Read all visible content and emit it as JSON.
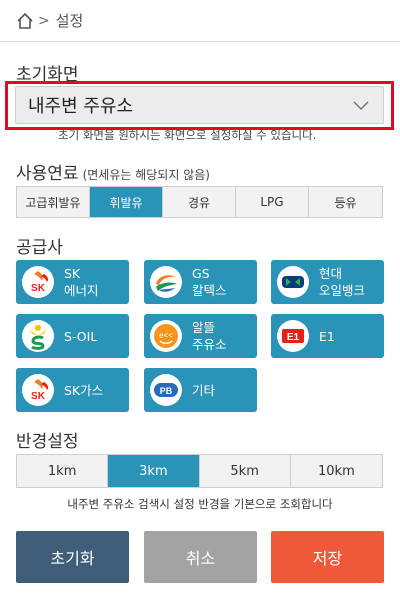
{
  "breadcrumb": {
    "separator": ">",
    "current": "설정"
  },
  "initial_screen": {
    "title": "초기화면",
    "selected": "내주변 주유소",
    "obscured_hint": "초기 화면을 원하시는 화면으로 설정하실 수 있습니다."
  },
  "fuel": {
    "title": "사용연료",
    "note": "(면세유는 해당되지 않음)",
    "options": [
      "고급휘발유",
      "휘발유",
      "경유",
      "LPG",
      "등유"
    ],
    "selected": "휘발유"
  },
  "suppliers": {
    "title": "공급사",
    "items": [
      {
        "name": "SK\n에너지",
        "icon": "sk-logo-icon"
      },
      {
        "name": "GS\n칼텍스",
        "icon": "gs-logo-icon"
      },
      {
        "name": "현대\n오일뱅크",
        "icon": "hyundai-oilbank-logo-icon"
      },
      {
        "name": "S-OIL",
        "icon": "s-oil-logo-icon"
      },
      {
        "name": "알뜰\n주유소",
        "icon": "altteul-logo-icon"
      },
      {
        "name": "E1",
        "icon": "e1-logo-icon"
      },
      {
        "name": "SK가스",
        "icon": "sk-gas-logo-icon"
      },
      {
        "name": "기타",
        "icon": "pb-logo-icon"
      }
    ],
    "logo_text": {
      "sk": "SK",
      "e1": "E1",
      "pb": "PB",
      "altteul": "e<<"
    }
  },
  "radius": {
    "title": "반경설정",
    "options": [
      "1km",
      "3km",
      "5km",
      "10km"
    ],
    "selected": "3km",
    "description": "내주변 주유소 검색시 설정 반경을 기본으로 조회합니다"
  },
  "actions": {
    "reset": "초기화",
    "cancel": "취소",
    "save": "저장"
  },
  "colors": {
    "accent": "#2a93b8",
    "highlight": "#e20b24",
    "reset": "#3d5d78",
    "cancel": "#a3a3a3",
    "save": "#f0583a"
  }
}
